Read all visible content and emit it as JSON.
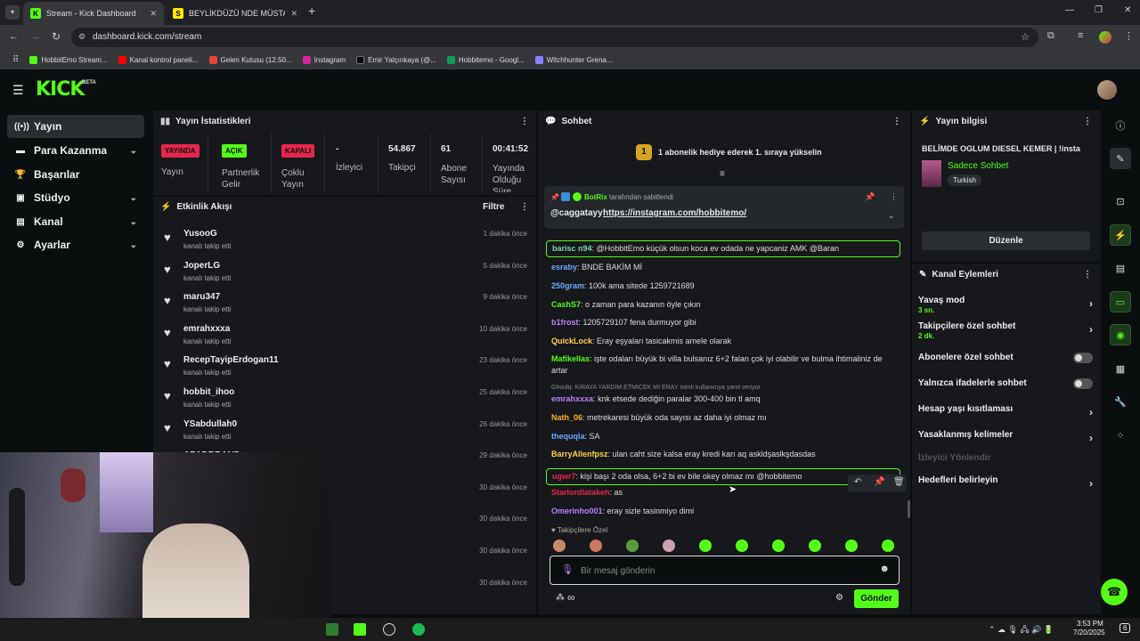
{
  "browser": {
    "tabs": [
      {
        "title": "Stream - Kick Dashboard",
        "favicon": "K"
      },
      {
        "title": "BEYLİKDÜZÜ NDE MÜSTAKİL H",
        "favicon": "S"
      }
    ],
    "new_tab": "+",
    "url": "dashboard.kick.com/stream",
    "bookmarks": [
      "HobbitEmo Stream...",
      "Kanal kontrol paneli...",
      "Gelen Kutusu (12.50...",
      "Instagram",
      "Emir Yalçınkaya (@...",
      "Hobbitemo - Googl...",
      "Witchhunter Grena..."
    ]
  },
  "brand": {
    "logo": "KICK",
    "beta": "BETA",
    "accent": "#53fc18"
  },
  "sidebar": {
    "items": [
      {
        "label": "Yayın",
        "icon": "broadcast-icon",
        "active": true
      },
      {
        "label": "Para Kazanma",
        "icon": "money-icon",
        "chevron": true
      },
      {
        "label": "Başarılar",
        "icon": "trophy-icon"
      },
      {
        "label": "Stüdyo",
        "icon": "studio-icon",
        "chevron": true
      },
      {
        "label": "Kanal",
        "icon": "channel-icon",
        "chevron": true
      },
      {
        "label": "Ayarlar",
        "icon": "gear-icon",
        "chevron": true
      }
    ]
  },
  "stats": {
    "title": "Yayın İstatistikleri",
    "items": [
      {
        "badge": "YAYINDA",
        "label": "Yayın",
        "color": "#e5274b"
      },
      {
        "badge": "AÇIK",
        "label": "Partnerlik Gelir",
        "color": "#53fc18"
      },
      {
        "badge": "KAPALI",
        "label": "Çoklu Yayın",
        "color": "#e5274b"
      },
      {
        "value": "-",
        "label": "İzleyici"
      },
      {
        "value": "54.867",
        "label": "Takipçi"
      },
      {
        "value": "61",
        "label": "Abone Sayısı"
      },
      {
        "value": "00:41:52",
        "label": "Yayında Olduğu Süre"
      }
    ]
  },
  "activity": {
    "title": "Etkinlik Akışı",
    "filter": "Filtre",
    "events": [
      {
        "name": "YusooG",
        "action": "kanalı takip etti",
        "time": "1 dakika önce"
      },
      {
        "name": "JoperLG",
        "action": "kanalı takip etti",
        "time": "5 dakika önce"
      },
      {
        "name": "maru347",
        "action": "kanalı takip etti",
        "time": "9 dakika önce"
      },
      {
        "name": "emrahxxxa",
        "action": "kanalı takip etti",
        "time": "10 dakika önce"
      },
      {
        "name": "RecepTayipErdogan11",
        "action": "kanalı takip etti",
        "time": "23 dakika önce"
      },
      {
        "name": "hobbit_ihoo",
        "action": "kanalı takip etti",
        "time": "25 dakika önce"
      },
      {
        "name": "YSabdullah0",
        "action": "kanalı takip etti",
        "time": "26 dakika önce"
      },
      {
        "name": "AZADBRAND",
        "action": "",
        "time": "29 dakika önce"
      },
      {
        "name": "",
        "action": "",
        "time": "30 dakika önce"
      },
      {
        "name": "",
        "action": "",
        "time": "30 dakika önce"
      },
      {
        "name": "",
        "action": "",
        "time": "30 dakika önce"
      },
      {
        "name": "",
        "action": "",
        "time": "30 dakika önce"
      }
    ]
  },
  "chat": {
    "title": "Sohbet",
    "gift_banner": "1 abonelik hediye ederek 1. sıraya yükselin",
    "gift_rank": "1",
    "pinned": {
      "by": "BotRix",
      "by_suffix": "tarafından sabitlendi",
      "user": "@caggatayy",
      "link": "https://instagram.com/hobbitemo/"
    },
    "messages": [
      {
        "user": "barisc n94",
        "text": "@HobbitEmo küçük olsun koca ev odada ne yapcaniz AMK @Baran",
        "color": "#7ad3a8",
        "highlight": true
      },
      {
        "user": "esraby",
        "text": "BNDE BAKİM Mİ",
        "color": "#6fa8ff"
      },
      {
        "user": "250gram",
        "text": "100k ama sitede 1259721689",
        "color": "#6fa8ff"
      },
      {
        "user": "CashS7",
        "text": "o zaman para kazanın öyle çıkın",
        "color": "#53fc18"
      },
      {
        "user": "b1frost",
        "text": "1205729107 fena durmuyor gibi",
        "color": "#c07cff"
      },
      {
        "user": "QuickLock",
        "text": "Eray eşyaları tasicakmis amele olarak",
        "color": "#ffd24d"
      },
      {
        "user": "Mafikellas",
        "text": "işte odaları büyük bi villa bulsanız 6+2 falan çok iyi olabilir ve bulma ihtimaliniz de artar",
        "color": "#53fc18"
      },
      {
        "reply": "Ghoulq: KİRAYA YARDIM ETMİCEK Mİ ERAY isimli kullanıcıya yanıt veriyor",
        "user": "emrahxxxa",
        "text": "knk etsede dediğin paralar 300-400 bin tl amq",
        "color": "#c07cff"
      },
      {
        "user": "Nath_06",
        "text": "metrekaresi büyük oda sayısı az daha iyi olmaz mı",
        "color": "#ffb020"
      },
      {
        "user": "thequqla",
        "text": "SA",
        "color": "#6fa8ff"
      },
      {
        "user": "BarryAllenfpsz",
        "text": "ulan caht size kalsa eray kredi karı aq askldşaslkşdasdas",
        "color": "#ffd24d"
      },
      {
        "user": "ugwr7",
        "text": "kişi başı 2 oda olsa, 6+2 bi ev bile okey olmaz mı @hobbitemo",
        "color": "#e5274b",
        "highlight": true
      },
      {
        "user": "Starlordlatakeh",
        "text": "as",
        "color": "#e5274b"
      },
      {
        "user": "Omerinho001",
        "text": "eray sizle tasinmiyo dimi",
        "color": "#c07cff"
      }
    ],
    "followers_only": "Takipçilere Özel",
    "input_placeholder": "Bir mesaj gönderin",
    "send": "Gönder",
    "infinity": "∞"
  },
  "stream_info": {
    "title": "Yayın bilgisi",
    "stream_title": "BELİMDE OGLUM DIESEL KEMER | !insta",
    "category": "Sadece Sohbet",
    "tag": "Turkish",
    "edit": "Düzenle"
  },
  "channel_actions": {
    "title": "Kanal Eylemleri",
    "items": [
      {
        "label": "Yavaş mod",
        "sub": "3 sn.",
        "type": "arrow"
      },
      {
        "label": "Takipçilere özel sohbet",
        "sub": "2 dk.",
        "type": "arrow"
      },
      {
        "label": "Abonelere özel sohbet",
        "type": "toggle"
      },
      {
        "label": "Yalnızca ifadelerle sohbet",
        "type": "toggle"
      },
      {
        "label": "Hesap yaşı kısıtlaması",
        "type": "arrow"
      },
      {
        "label": "Yasaklanmış kelimeler",
        "type": "arrow"
      },
      {
        "label": "İzleyici Yönlendir",
        "type": "disabled"
      },
      {
        "label": "Hedefleri belirleyin",
        "type": "arrow"
      }
    ]
  },
  "taskbar": {
    "time": "3:53 PM",
    "date": "7/20/2025",
    "notif": "6"
  }
}
